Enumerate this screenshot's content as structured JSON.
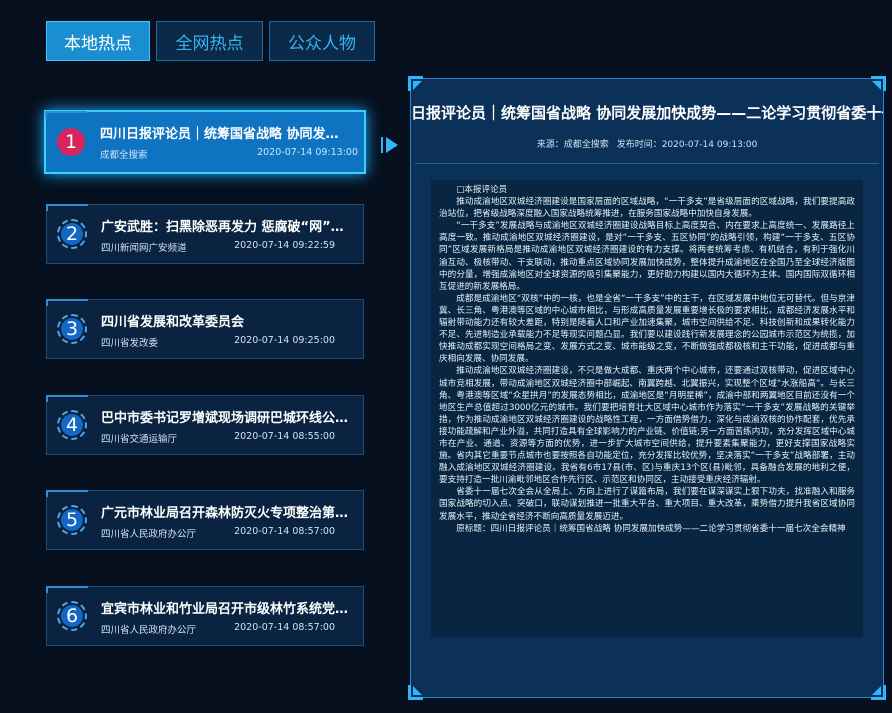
{
  "tabs": [
    {
      "label": "本地热点",
      "active": true
    },
    {
      "label": "全网热点",
      "active": false
    },
    {
      "label": "公众人物",
      "active": false
    }
  ],
  "list": [
    {
      "num": "1",
      "title": "四川日报评论员｜统筹国省战略 协同发展...",
      "source": "成都全搜索",
      "time": "2020-07-14 09:13:00"
    },
    {
      "num": "2",
      "title": "广安武胜：扫黑除恶再发力 惩腐破“网”不...",
      "source": "四川新闻网广安频道",
      "time": "2020-07-14 09:22:59"
    },
    {
      "num": "3",
      "title": "四川省发展和改革委员会",
      "source": "四川省发改委",
      "time": "2020-07-14 09:25:00"
    },
    {
      "num": "4",
      "title": "巴中市委书记罗增斌现场调研巴城环线公路...",
      "source": "四川省交通运输厅",
      "time": "2020-07-14 08:55:00"
    },
    {
      "num": "5",
      "title": "广元市林业局召开森林防灭火专项整治第二...",
      "source": "四川省人民政府办公厅",
      "time": "2020-07-14 08:57:00"
    },
    {
      "num": "6",
      "title": "宜宾市林业和竹业局召开市级林竹系统党风...",
      "source": "四川省人民政府办公厅",
      "time": "2020-07-14 08:57:00"
    }
  ],
  "detail": {
    "title": "四川日报评论员｜统筹国省战略 协同发展加快成势——二论学习贯彻省委十一届七次全会精神",
    "source_label": "来源：成都全搜索",
    "time_label": "发布时间：2020-07-14 09:13:00",
    "paragraphs": [
      "□本报评论员",
      "推动成渝地区双城经济圈建设是国家层面的区域战略，“一干多支”是省级层面的区域战略，我们要提高政治站位，把省级战略深度融入国家战略统筹推进，在服务国家战略中加快自身发展。",
      "“一干多支”发展战略与成渝地区双城经济圈建设战略目标上高度契合、内在要求上高度统一、发展路径上高度一致。推动成渝地区双城经济圈建设，是对“一干多支、五区协同”的战略引领，构建“一干多支、五区协同”区域发展新格局是推动成渝地区双城经济圈建设的有力支撑。将两者统筹考虑、有机结合，有利于强化川渝互动、极核带动、干支联动，推动重点区域协同发展加快成势，整体提升成渝地区在全国乃至全球经济版图中的分量，增强成渝地区对全球资源的吸引集聚能力，更好助力构建以国内大循环为主体、国内国际双循环相互促进的新发展格局。",
      "成都是成渝地区“双核”中的一核，也是全省“一干多支”中的主干，在区域发展中地位无可替代。但与京津冀、长三角、粤港澳等区域的中心城市相比，与形成高质量发展重要增长极的要求相比，成都经济发展水平和辐射带动能力还有较大差距，特别是随着人口和产业加速集聚，城市空间供给不足、科技创新和成果转化能力不足、先进制造业承载能力不足等现实问题凸显。我们要以建设践行新发展理念的公园城市示范区为统揽，加快推动成都实现空间格局之变、发展方式之变、城市能级之变，不断做强成都极核和主干功能，促进成都与重庆相向发展、协同发展。",
      "推动成渝地区双城经济圈建设，不只是做大成都、重庆两个中心城市，还要通过双核带动，促进区域中心城市竞相发展，带动成渝地区双城经济圈中部崛起、南翼跨越、北翼振兴，实现整个区域“水涨船高”。与长三角、粤港澳等区域“众星拱月”的发展态势相比，成渝地区是“月明星稀”，成渝中部和两翼地区目前还没有一个地区生产总值超过3000亿元的城市。我们要把培育壮大区域中心城市作为落实“一干多支”发展战略的关键举措，作为推动成渝地区双城经济圈建设的战略性工程，一方面借势借力，深化与成渝双核的协作配套，优先承接功能疏解和产业外溢，共同打造具有全球影响力的产业链、价值链;另一方面苦练内功，充分发挥区域中心城市在产业、通道、资源等方面的优势，进一步扩大城市空间供给，提升要素集聚能力，更好支撑国家战略实施。省内其它重要节点城市也要按照各自功能定位，充分发挥比较优势，坚决落实“一干多支”战略部署，主动融入成渝地区双城经济圈建设。我省有6市17县(市、区)与重庆13个区(县)毗邻，具备融合发展的地利之便，要支持打造一批川渝毗邻地区合作先行区、示范区和协同区，主动接受重庆经济辐射。",
      "省委十一届七次全会从全局上、方向上进行了谋篇布局，我们要在谋深谋实上狠下功夫，找准融入和服务国家战略的切入点、突破口，联动谋划推进一批重大平台、重大项目、重大改革，乘势借力提升我省区域协同发展水平，推动全省经济不断向高质量发展迈进。",
      "原标题：四川日报评论员｜统筹国省战略 协同发展加快成势——二论学习贯彻省委十一届七次全会精神"
    ]
  },
  "colors": {
    "background": "#06101e",
    "accent": "#2fb6ff",
    "active_item": "#0e74c2",
    "active_badge": "#d8255e"
  }
}
